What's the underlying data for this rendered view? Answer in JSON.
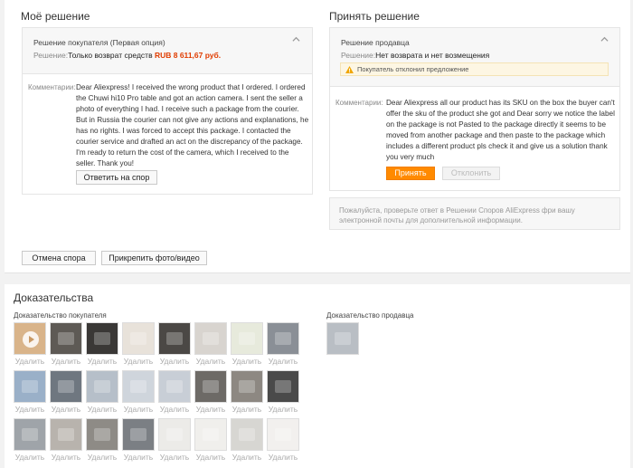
{
  "my_decision": {
    "title": "Моё решение",
    "panel_title": "Решение покупателя (Первая опция)",
    "decision_label": "Решение:",
    "decision_value": "Только возврат средств",
    "amount": "RUB 8 611,67 руб.",
    "comment_label": "Комментарии:",
    "comment_lines": [
      "Dear Aliexpress! I received the wrong product that I ordered. I ordered",
      "the Chuwi hi10 Pro table and got an action camera. I sent the seller a",
      "photo of everything I had. I receive such a package from the courier.",
      "But in Russia the courier can not give any actions and explanations, he",
      "has no rights. I was forced to accept this package. I contacted the",
      "courier service and drafted an act on the discrepancy of the package.",
      "I'm ready to return the cost of the camera, which I received to the",
      "seller. Thank you!"
    ],
    "reply_button": "Ответить на спор"
  },
  "accept_decision": {
    "title": "Принять решение",
    "panel_title": "Решение продавца",
    "decision_label": "Решение:",
    "decision_value": "Нет возврата и нет возмещения",
    "warning": "Покупатель отклонил предложение",
    "comment_label": "Комментарии:",
    "comment_lines": [
      "Dear Aliexpress all our product has its SKU on the box the buyer can't",
      "offer the sku of the product she got and Dear sorry we notice the label",
      "on the package is not Pasted to the package directly it seems to be",
      "moved from another package and then paste to the package which",
      "includes a different product pls check it and give us a solution thank",
      "you very much"
    ],
    "accept_button": "Принять",
    "reject_button": "Отклонить",
    "notice_lines": [
      "Пожалуйста, проверьте ответ в Решении Споров AliExpress фри вашу",
      "электронной почты для дополнительной информации."
    ]
  },
  "actions": {
    "cancel_dispute": "Отмена спора",
    "attach_media": "Прикрепить фото/видео"
  },
  "evidence": {
    "title": "Доказательства",
    "buyer_label": "Доказательство покупателя",
    "seller_label": "Доказательство продавца",
    "delete_label": "Удалить",
    "buyer_thumbs": [
      {
        "kind": "video",
        "bg": "#d9b48a"
      },
      {
        "kind": "photo",
        "bg": "#5e5a55"
      },
      {
        "kind": "photo",
        "bg": "#3a3836"
      },
      {
        "kind": "photo",
        "bg": "#e8e2da"
      },
      {
        "kind": "photo",
        "bg": "#4b4845"
      },
      {
        "kind": "photo",
        "bg": "#d8d4cf"
      },
      {
        "kind": "photo",
        "bg": "#e7eadc"
      },
      {
        "kind": "photo",
        "bg": "#8a8f96"
      },
      {
        "kind": "photo",
        "bg": "#9ab0c8"
      },
      {
        "kind": "photo",
        "bg": "#6f7780"
      },
      {
        "kind": "photo",
        "bg": "#b6bfc9"
      },
      {
        "kind": "photo",
        "bg": "#cfd5dc"
      },
      {
        "kind": "photo",
        "bg": "#c8ced6"
      },
      {
        "kind": "photo",
        "bg": "#6d6a66"
      },
      {
        "kind": "photo",
        "bg": "#8d8882"
      },
      {
        "kind": "photo",
        "bg": "#4a4a4a"
      },
      {
        "kind": "photo",
        "bg": "#9fa4a9"
      },
      {
        "kind": "photo",
        "bg": "#b8b3ad"
      },
      {
        "kind": "photo",
        "bg": "#8e8b86"
      },
      {
        "kind": "photo",
        "bg": "#7b7f84"
      },
      {
        "kind": "photo",
        "bg": "#ecebe8"
      },
      {
        "kind": "photo",
        "bg": "#f0efec"
      },
      {
        "kind": "photo",
        "bg": "#d7d6d2"
      },
      {
        "kind": "photo",
        "bg": "#f2f0ee"
      }
    ],
    "seller_thumbs": [
      {
        "kind": "photo",
        "bg": "#b9bec4"
      }
    ]
  },
  "colors": {
    "accent": "#ff8a00",
    "amount": "#e03c00"
  }
}
